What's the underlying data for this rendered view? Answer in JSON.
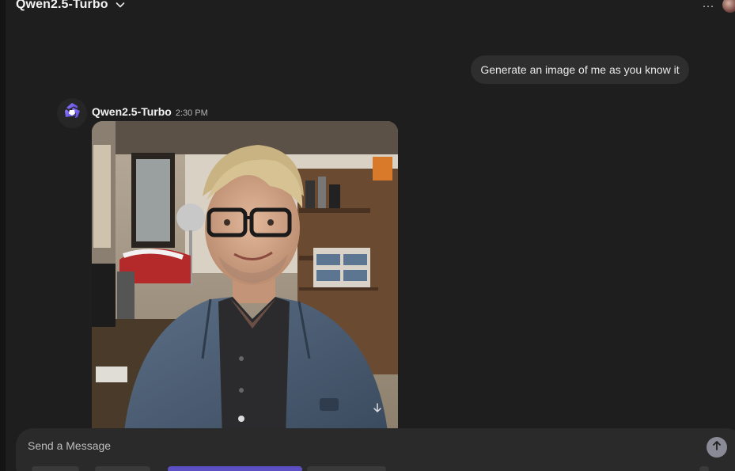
{
  "header": {
    "model_name": "Qwen2.5-Turbo",
    "more_label": "···"
  },
  "conversation": {
    "user_message": "Generate an image of me as you know it",
    "assistant": {
      "name": "Qwen2.5-Turbo",
      "time": "2:30 PM"
    }
  },
  "composer": {
    "placeholder": "Send a Message"
  },
  "icons": {
    "model_chevron": "chevron-down-icon",
    "more": "more-horizontal-icon",
    "assistant_logo": "qwen-logo-icon",
    "scroll_down": "arrow-down-icon",
    "send": "arrow-up-icon"
  },
  "colors": {
    "background": "#1e1e1e",
    "bubble": "#2e2e2e",
    "composer": "#2a2a2a",
    "accent": "#6b5bd6",
    "send_button": "#8a8a96"
  }
}
